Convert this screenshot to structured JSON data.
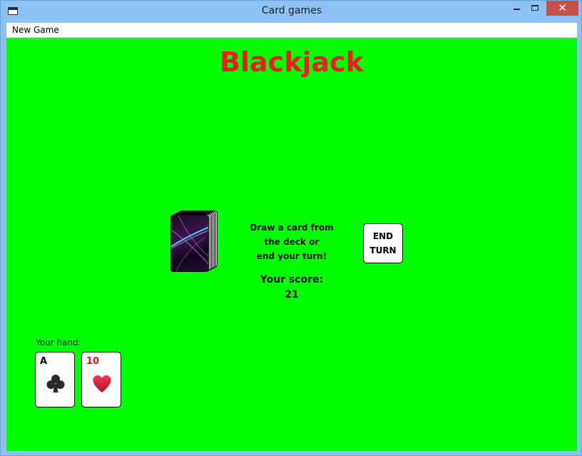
{
  "window": {
    "title": "Card games",
    "close_glyph": "✕"
  },
  "menu": {
    "items": [
      {
        "label": "New Game"
      }
    ]
  },
  "game": {
    "title": "Blackjack",
    "instructions": [
      "Draw a card from",
      "the deck or",
      "end your turn!"
    ],
    "score_label": "Your score:",
    "score_value": "21",
    "end_turn_lines": [
      "END",
      "TURN"
    ],
    "hand_label": "Your hand:",
    "hand": [
      {
        "rank": "A",
        "suit": "clubs",
        "suit_icon": "club-icon",
        "color": "#000000"
      },
      {
        "rank": "10",
        "suit": "hearts",
        "suit_icon": "heart-icon",
        "color": "#e01b1b"
      }
    ]
  },
  "colors": {
    "table": "#00ff00",
    "title": "#ee1c24",
    "close_button": "#c7504b"
  }
}
